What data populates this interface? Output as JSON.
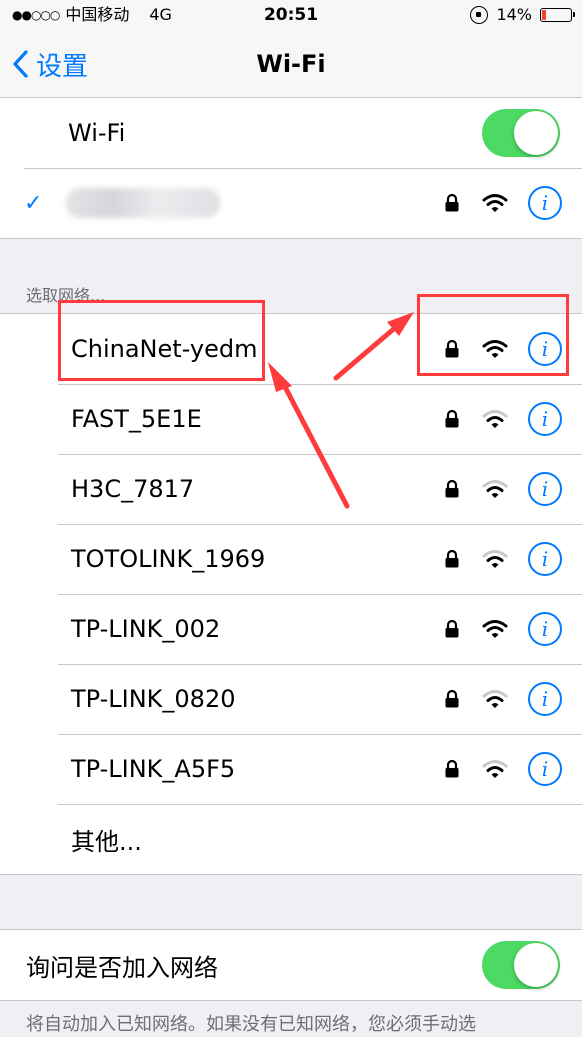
{
  "status_bar": {
    "signal": "●●○○○",
    "carrier": "中国移动",
    "network": "4G",
    "time": "20:51",
    "battery_percent_text": "14%",
    "battery_level": 0.14
  },
  "nav": {
    "back_label": "设置",
    "title": "Wi-Fi"
  },
  "wifi_toggle": {
    "label": "Wi-Fi",
    "on": true
  },
  "connected_network": {
    "checked": true,
    "ssid_redacted": true,
    "secured": true,
    "signal_bars": 3
  },
  "section_header": "选取网络...",
  "networks": [
    {
      "ssid": "ChinaNet-yedm",
      "secured": true,
      "signal_bars": 3
    },
    {
      "ssid": "FAST_5E1E",
      "secured": true,
      "signal_bars": 2
    },
    {
      "ssid": "H3C_7817",
      "secured": true,
      "signal_bars": 2
    },
    {
      "ssid": "TOTOLINK_1969",
      "secured": true,
      "signal_bars": 2
    },
    {
      "ssid": "TP-LINK_002",
      "secured": true,
      "signal_bars": 3
    },
    {
      "ssid": "TP-LINK_0820",
      "secured": true,
      "signal_bars": 2
    },
    {
      "ssid": "TP-LINK_A5F5",
      "secured": true,
      "signal_bars": 2
    }
  ],
  "other_label": "其他...",
  "ask_to_join": {
    "label": "询问是否加入网络",
    "on": true
  },
  "footer_text": "将自动加入已知网络。如果没有已知网络，您必须手动选",
  "info_glyph": "i",
  "check_glyph": "✓",
  "colors": {
    "accent": "#007aff",
    "toggle_on": "#4cd964",
    "annotation": "#ff3b3b",
    "battery_low": "#ff3b30"
  }
}
